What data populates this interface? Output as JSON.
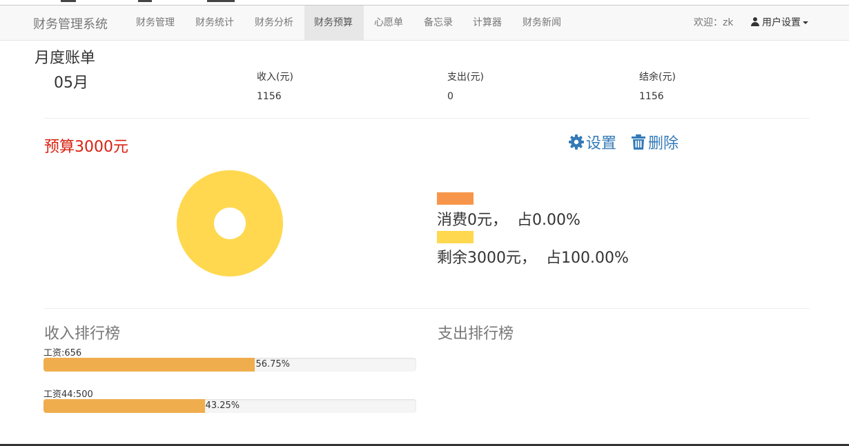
{
  "navbar": {
    "brand": "财务管理系统",
    "items": [
      {
        "label": "财务管理"
      },
      {
        "label": "财务统计"
      },
      {
        "label": "财务分析"
      },
      {
        "label": "财务预算",
        "active": true
      },
      {
        "label": "心愿单"
      },
      {
        "label": "备忘录"
      },
      {
        "label": "计算器"
      },
      {
        "label": "财务新闻"
      }
    ],
    "welcome": "欢迎：zk",
    "user_menu": "用户设置"
  },
  "bill": {
    "title": "月度账单",
    "month": "05月",
    "income_label": "收入(元)",
    "income_value": "1156",
    "expense_label": "支出(元)",
    "expense_value": "0",
    "balance_label": "结余(元)",
    "balance_value": "1156"
  },
  "budget": {
    "title": "预算3000元",
    "settings_label": "设置",
    "delete_label": "删除",
    "legend": [
      {
        "text": "消费0元，  占0.00%",
        "color": "#f7964a",
        "value": 0
      },
      {
        "text": "剩余3000元，  占100.00%",
        "color": "#ffd84f",
        "value": 3000
      }
    ]
  },
  "income_rank": {
    "title": "收入排行榜",
    "items": [
      {
        "label": "工资:656",
        "percent_text": "56.75%",
        "percent": 56.75
      },
      {
        "label": "工资44:500",
        "percent_text": "43.25%",
        "percent": 43.25
      }
    ]
  },
  "expense_rank": {
    "title": "支出排行榜"
  },
  "colors": {
    "accent": "#337ab7",
    "budget_red": "#d9200f",
    "bar": "#f0ad4e"
  }
}
